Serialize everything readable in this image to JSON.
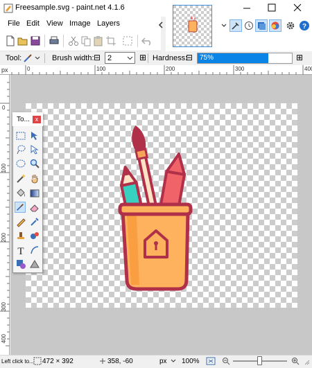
{
  "window": {
    "title": "Freesample.svg - paint.net 4.1.6"
  },
  "menu": {
    "items": [
      "File",
      "Edit",
      "View",
      "Image",
      "Layers"
    ]
  },
  "options": {
    "tool_label": "Tool:",
    "brush_width_label": "Brush width:",
    "brush_width_value": "2",
    "hardness_label": "Hardness:",
    "hardness_value": "75%",
    "hardness_fraction": 0.75,
    "minus": "⊟",
    "plus": "⊞"
  },
  "ruler": {
    "h_labels": [
      "px",
      "0",
      "100",
      "200",
      "300",
      "400"
    ],
    "v_labels": [
      "0",
      "100",
      "200",
      "300",
      "400"
    ]
  },
  "tools_window": {
    "title": "To...",
    "close": "x"
  },
  "status": {
    "hint": "Left click to...",
    "image_size": "472 × 392",
    "cursor_pos": "358, -60",
    "units": "px",
    "zoom": "100%"
  },
  "colors": {
    "accent": "#0078d7",
    "hardness_bar": "#0a84e6",
    "pencil_orange": "#ffb25e",
    "pencil_red": "#f06368"
  }
}
